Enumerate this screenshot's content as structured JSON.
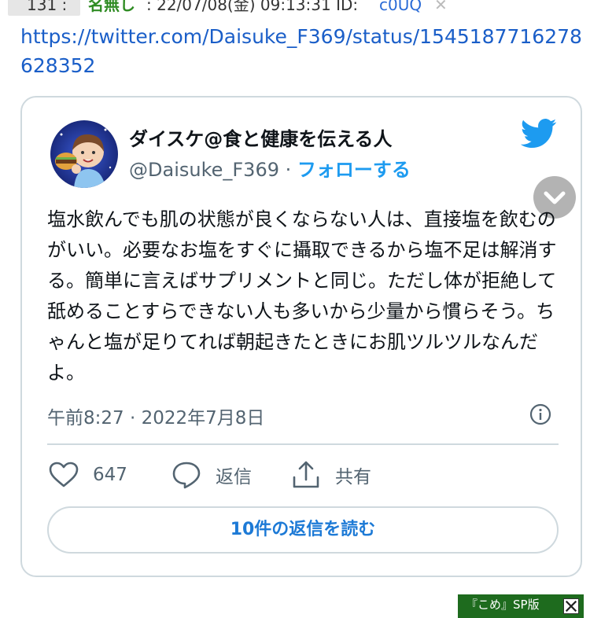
{
  "post": {
    "number": "131 :",
    "name": "名無し",
    "date": ": 22/07/08(金) 09:13:31 ID:",
    "id": "c0UQ",
    "close": "✕",
    "url": "https://twitter.com/Daisuke_F369/status/1545187716278628352"
  },
  "tweet": {
    "display_name": "ダイスケ@食と健康を伝える人",
    "handle": "@Daisuke_F369",
    "separator": " · ",
    "follow": "フォローする",
    "text": "塩水飲んでも肌の状態が良くならない人は、直接塩を飲むのがいい。必要なお塩をすぐに攝取できるから塩不足は解消する。簡単に言えばサプリメントと同じ。ただし体が拒絶して舐めることすらできない人も多いから少量から慣らそう。ちゃんと塩が足りてれば朝起きたときにお肌ツルツルなんだよ。",
    "time": "午前8:27 · 2022年7月8日",
    "likes": "647",
    "reply_label": "返信",
    "share_label": "共有",
    "read_replies": "10件の返信を読む"
  },
  "badge": {
    "label": "『こめ』SP版"
  },
  "colors": {
    "twitter_blue": "#1d9bf0",
    "name_green": "#2e8b22",
    "badge_green": "#1e6b1e"
  }
}
